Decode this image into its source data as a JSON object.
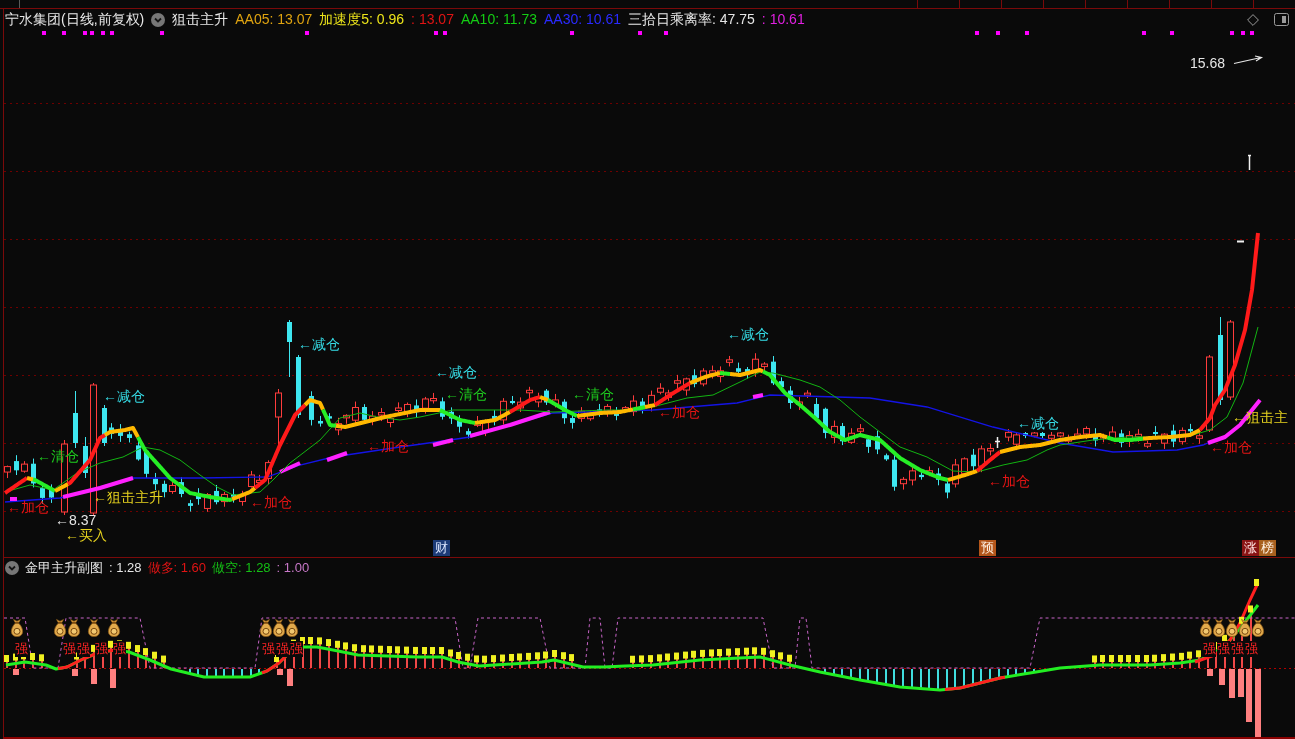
{
  "header": {
    "title": "宁水集团(日线,前复权)",
    "indicator": "狙击主升",
    "values": [
      {
        "text": "AA05: 13.07",
        "color": "#e0a410"
      },
      {
        "text": "加速度5: 0.96",
        "color": "#ece41a"
      },
      {
        "text": ": 13.07",
        "color": "#e01414"
      },
      {
        "text": "AA10: 11.73",
        "color": "#14cc14"
      },
      {
        "text": "AA30: 10.61",
        "color": "#2a2aff"
      },
      {
        "text": "三拾日乘离率: 47.75",
        "color": "#e6e6e6"
      },
      {
        "text": ": 10.61",
        "color": "#e020e0"
      }
    ]
  },
  "main_chart": {
    "annotations": [
      {
        "text": "←减仓",
        "kind": "reduce"
      },
      {
        "text": "←清仓",
        "kind": "clear"
      },
      {
        "text": "←狙击主升",
        "kind": "rise"
      },
      {
        "text": "←加仓",
        "kind": "add"
      },
      {
        "text": "←8.37",
        "kind": "price"
      },
      {
        "text": "←买入",
        "kind": "buy"
      },
      {
        "text": "←减仓",
        "kind": "reduce"
      },
      {
        "text": "←加仓",
        "kind": "add"
      },
      {
        "text": "←减仓",
        "kind": "reduce"
      },
      {
        "text": "←清仓",
        "kind": "clear"
      },
      {
        "text": "←加仓",
        "kind": "add"
      },
      {
        "text": "←清仓",
        "kind": "clear"
      },
      {
        "text": "←加仓",
        "kind": "add"
      },
      {
        "text": "←减仓",
        "kind": "reduce"
      },
      {
        "text": "←减仓",
        "kind": "reduce"
      },
      {
        "text": "←加仓",
        "kind": "add"
      },
      {
        "text": "←狙击主",
        "kind": "rise"
      },
      {
        "text": "←加仓",
        "kind": "add"
      }
    ],
    "high_label": "15.68",
    "events": [
      {
        "text": "财",
        "kind": "finance"
      },
      {
        "text": "预",
        "kind": "forecast"
      },
      {
        "text": "涨",
        "kind": "limit_up"
      },
      {
        "text": "榜",
        "kind": "ranking"
      }
    ]
  },
  "sub_chart": {
    "title": "金甲主升副图",
    "values": [
      {
        "text": ": 1.28",
        "color": "#e6e6e6"
      },
      {
        "text": "做多: 1.60",
        "color": "#e01414"
      },
      {
        "text": "做空: 1.28",
        "color": "#14c014"
      },
      {
        "text": ": 1.00",
        "color": "#c878c8"
      }
    ],
    "signals": [
      "强",
      "强",
      "强",
      "强",
      "强",
      "强",
      "强",
      "强",
      "强",
      "强",
      "强",
      "强"
    ]
  }
}
